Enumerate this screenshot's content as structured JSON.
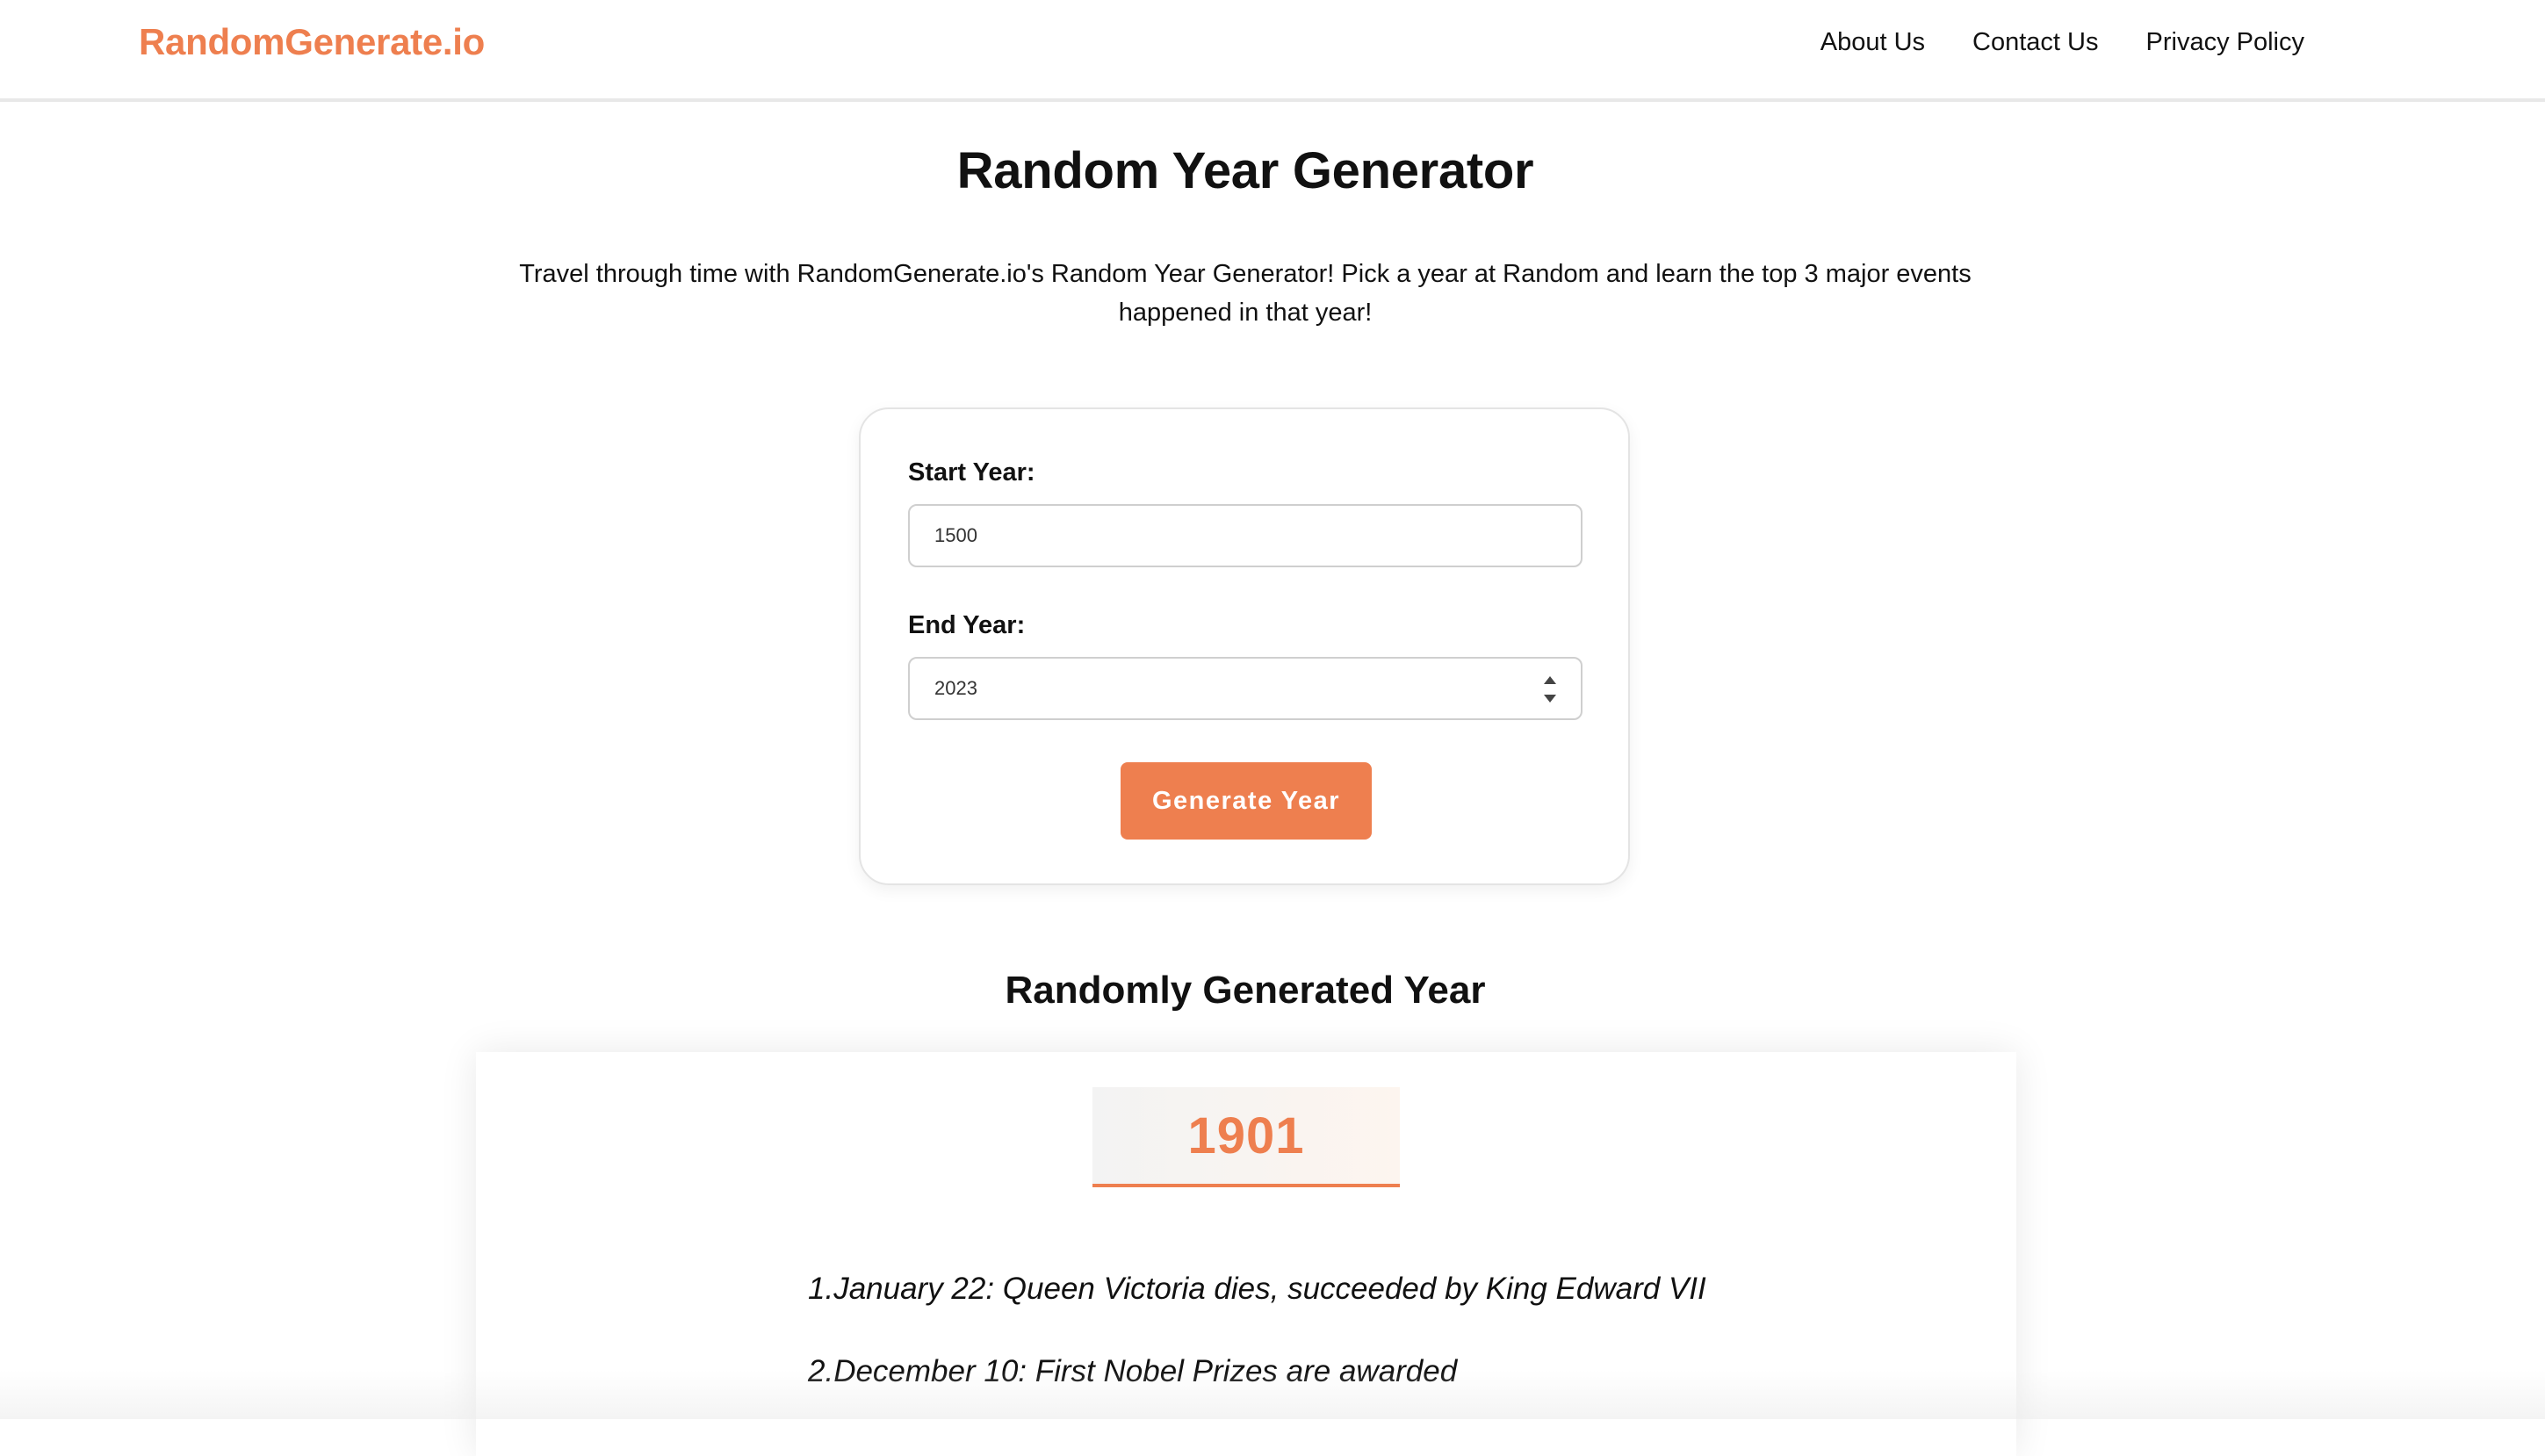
{
  "header": {
    "logo": "RandomGenerate.io",
    "nav": [
      {
        "label": "About Us"
      },
      {
        "label": "Contact Us"
      },
      {
        "label": "Privacy Policy"
      }
    ]
  },
  "main": {
    "title": "Random Year Generator",
    "intro": "Travel through time with RandomGenerate.io's Random Year Generator! Pick a year at Random and learn the top 3 major events happened in that year!"
  },
  "form": {
    "start_label": "Start Year:",
    "start_value": "1500",
    "end_label": "End Year:",
    "end_value": "2023",
    "button_label": "Generate Year"
  },
  "result": {
    "heading": "Randomly Generated Year",
    "year": "1901",
    "events": [
      "1.January 22: Queen Victoria dies, succeeded by King Edward VII",
      "2.December 10: First Nobel Prizes are awarded"
    ]
  },
  "colors": {
    "accent": "#ee7f4f"
  }
}
